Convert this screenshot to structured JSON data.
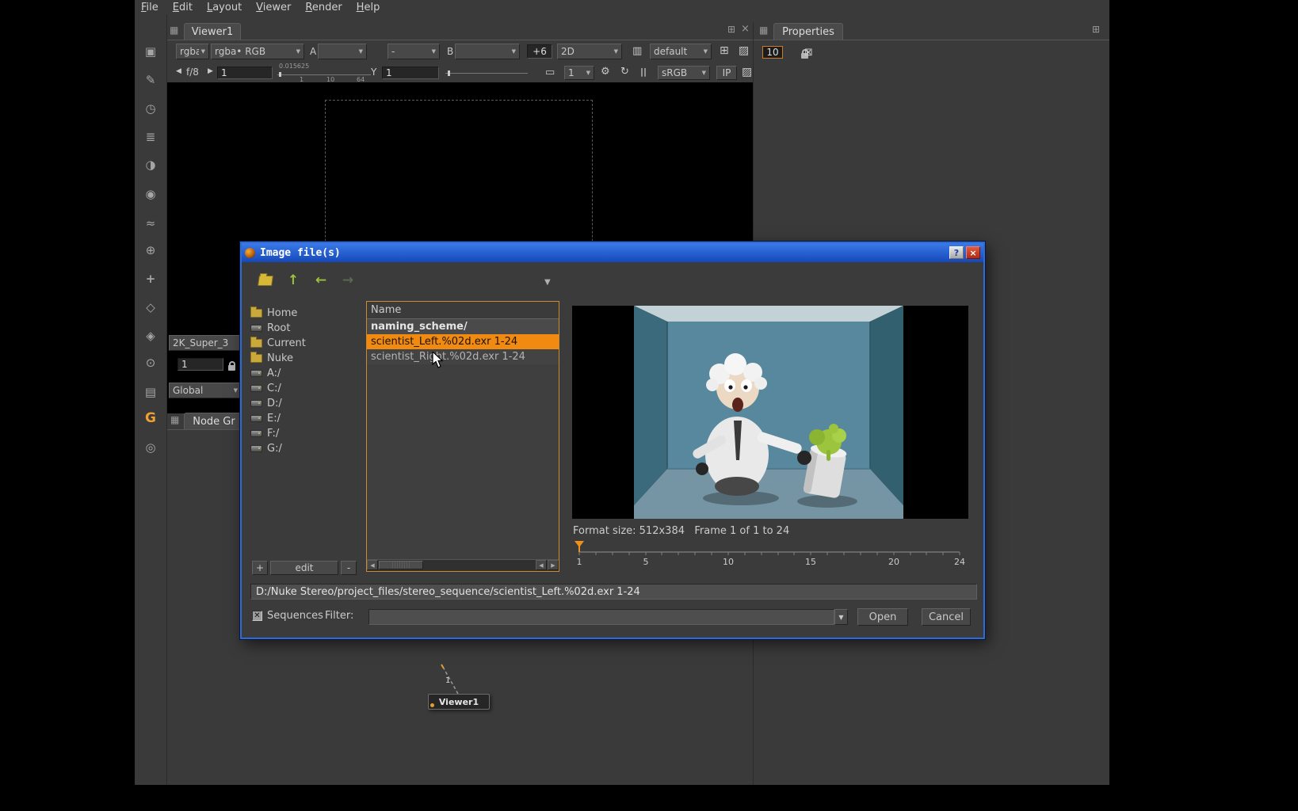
{
  "icons": {
    "chevron_down": "▼",
    "chevron_left": "◀",
    "chevron_right": "▶",
    "panel": "▦",
    "float_panel": "⊞",
    "close": "×",
    "gear": "⚙",
    "refresh": "↻",
    "pause": "||",
    "monitor": "▭",
    "checker": "▨",
    "stereo": "▥",
    "roi": "⊞",
    "clear": "⊠",
    "help": "?",
    "arrow_up": "↑",
    "arrow_left": "←",
    "arrow_right": "→",
    "check_mark": "✕"
  },
  "menu": {
    "items": [
      "File",
      "Edit",
      "Layout",
      "Viewer",
      "Render",
      "Help"
    ]
  },
  "left_toolbar": {
    "icons": [
      {
        "name": "image",
        "glyph": "▣"
      },
      {
        "name": "draw",
        "glyph": "✎"
      },
      {
        "name": "time",
        "glyph": "◷"
      },
      {
        "name": "channel",
        "glyph": "≣"
      },
      {
        "name": "color",
        "glyph": "◑"
      },
      {
        "name": "filter",
        "glyph": "◉"
      },
      {
        "name": "keyer",
        "glyph": "≈"
      },
      {
        "name": "merge",
        "glyph": "⊕"
      },
      {
        "name": "transform",
        "glyph": "+"
      },
      {
        "name": "3d",
        "glyph": "◇"
      },
      {
        "name": "particles",
        "glyph": "◈"
      },
      {
        "name": "views",
        "glyph": "⊙"
      },
      {
        "name": "deep",
        "glyph": "▤"
      },
      {
        "name": "gizmo",
        "glyph": "G"
      },
      {
        "name": "other",
        "glyph": "◎"
      }
    ]
  },
  "viewer": {
    "tab": "Viewer1",
    "row1": {
      "layer": "rgba",
      "channel": "rgba• RGB",
      "a_label": "A",
      "a_value": "",
      "ab_mode": "-",
      "b_label": "B",
      "b_value": "",
      "gain_badge": "+6",
      "dim_mode": "2D",
      "lut_preset": "default"
    },
    "row2": {
      "fstop": "f/8",
      "gain": "1",
      "gain_min": "0.015625",
      "tick1": "1",
      "tick2": "10",
      "tick3": "64",
      "gamma_label": "Y",
      "gamma": "1",
      "proxy": "1",
      "colorspace": "sRGB",
      "ip": "IP"
    }
  },
  "format_panel": {
    "format": "2K_Super_3",
    "frame": "1",
    "range": "Global"
  },
  "properties": {
    "tab": "Properties",
    "node_count": "10"
  },
  "node_graph": {
    "tab": "Node Gr",
    "node_label": "Viewer1",
    "wire_label": "1"
  },
  "dialog": {
    "title": "Image file(s)",
    "sidebar": {
      "items": [
        {
          "label": "Home",
          "type": "folder"
        },
        {
          "label": "Root",
          "type": "drive"
        },
        {
          "label": "Current",
          "type": "folder"
        },
        {
          "label": "Nuke",
          "type": "folder"
        },
        {
          "label": "A:/",
          "type": "drive"
        },
        {
          "label": "C:/",
          "type": "drive"
        },
        {
          "label": "D:/",
          "type": "drive"
        },
        {
          "label": "E:/",
          "type": "drive"
        },
        {
          "label": "F:/",
          "type": "drive"
        },
        {
          "label": "G:/",
          "type": "drive"
        }
      ],
      "add": "+",
      "edit": "edit",
      "remove": "-"
    },
    "files": {
      "header": "Name",
      "rows": [
        {
          "name": "naming_scheme/"
        },
        {
          "name": "scientist_Left.%02d.exr 1-24"
        },
        {
          "name": "scientist_Right.%02d.exr 1-24"
        }
      ]
    },
    "preview": {
      "format_info": "Format size: 512x384   Frame 1 of 1 to 24",
      "ticks": [
        "1",
        "5",
        "10",
        "15",
        "20",
        "24"
      ],
      "current_frame": "1"
    },
    "path": "D:/Nuke Stereo/project_files/stereo_sequence/scientist_Left.%02d.exr 1-24",
    "sequences": "Sequences",
    "filter": "Filter:",
    "filter_value": "",
    "open": "Open",
    "cancel": "Cancel"
  },
  "colors": {
    "selection": "#f08a10",
    "titlebar_blue": "#1f5fd6",
    "dialog_border": "#2e6bd8"
  }
}
